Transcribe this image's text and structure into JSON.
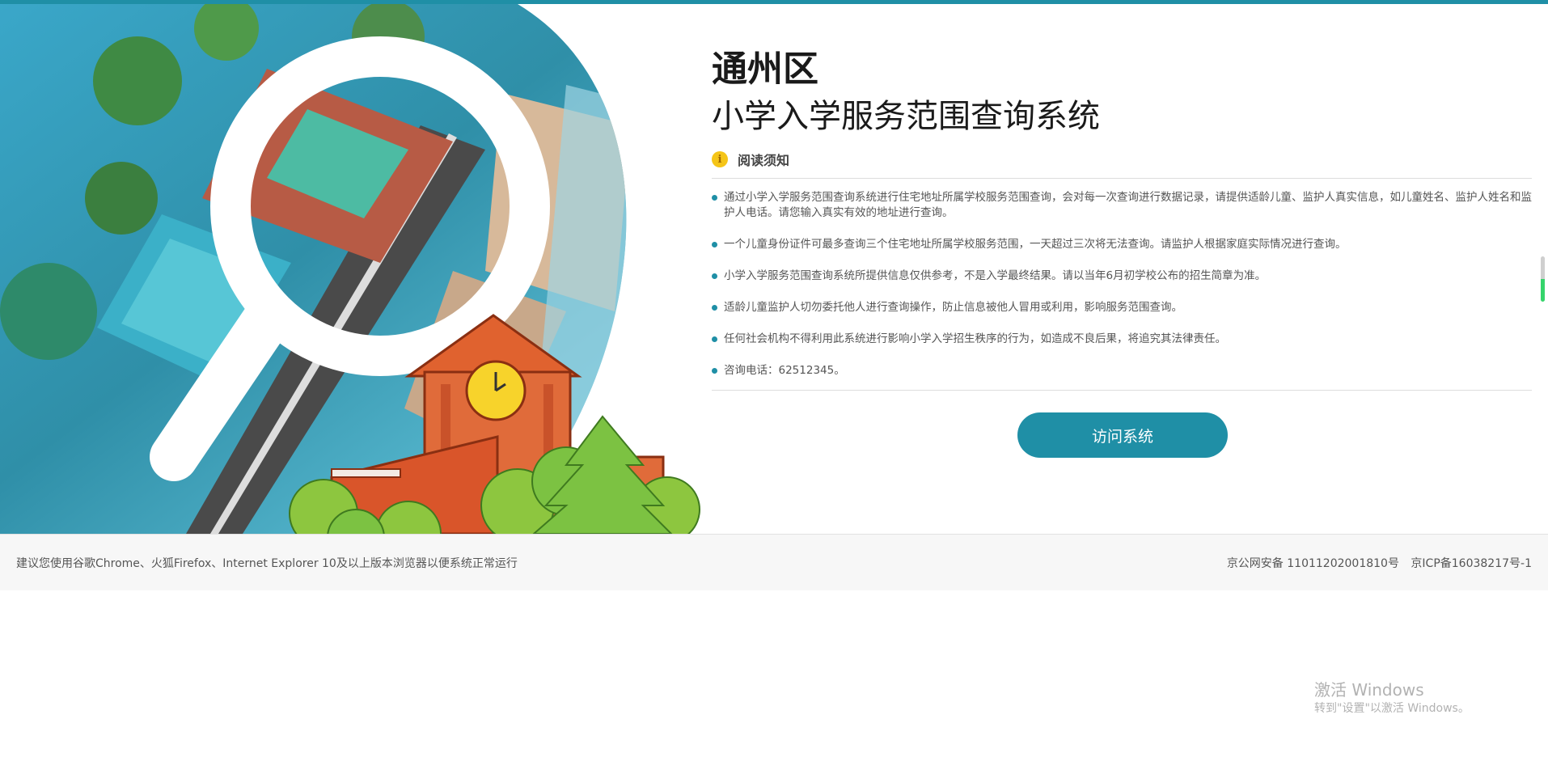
{
  "header": {
    "district": "通州区",
    "system_title": "小学入学服务范围查询系统"
  },
  "notice": {
    "icon": "info-icon",
    "title": "阅读须知",
    "items": [
      "通过小学入学服务范围查询系统进行住宅地址所属学校服务范围查询，会对每一次查询进行数据记录，请提供适龄儿童、监护人真实信息，如儿童姓名、监护人姓名和监护人电话。请您输入真实有效的地址进行查询。",
      "一个儿童身份证件可最多查询三个住宅地址所属学校服务范围，一天超过三次将无法查询。请监护人根据家庭实际情况进行查询。",
      "小学入学服务范围查询系统所提供信息仅供参考，不是入学最终结果。请以当年6月初学校公布的招生简章为准。",
      "适龄儿童监护人切勿委托他人进行查询操作，防止信息被他人冒用或利用，影响服务范围查询。",
      "任何社会机构不得利用此系统进行影响小学入学招生秩序的行为，如造成不良后果，将追究其法律责任。",
      "咨询电话：62512345。"
    ]
  },
  "actions": {
    "visit_label": "访问系统"
  },
  "footer": {
    "browser_tip": "建议您使用谷歌Chrome、火狐Firefox、Internet Explorer 10及以上版本浏览器以便系统正常运行",
    "police_record": "京公网安备 11011202001810号",
    "icp_record": "京ICP备16038217号-1"
  },
  "watermark": {
    "title": "激活 Windows",
    "subtitle": "转到\"设置\"以激活 Windows。"
  },
  "colors": {
    "accent": "#1f8fa6",
    "notice_icon": "#f5c518",
    "school_building": "#e0622f",
    "tree": "#7cc242"
  }
}
